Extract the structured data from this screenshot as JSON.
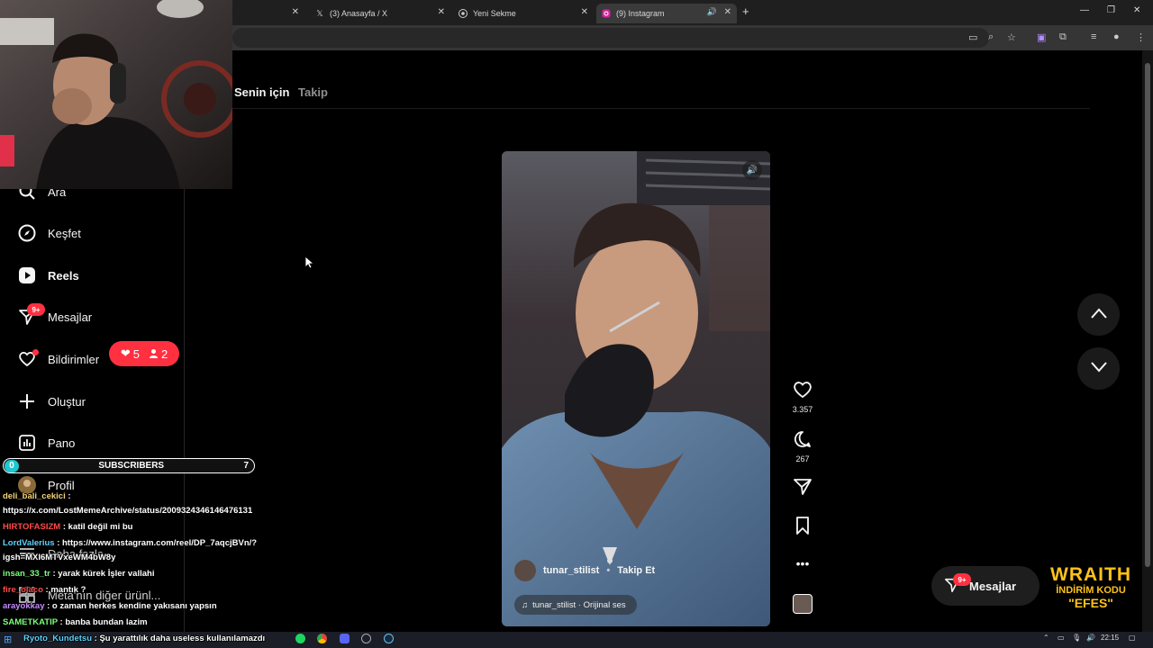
{
  "browser": {
    "tabs": [
      {
        "title": "",
        "icon": "close"
      },
      {
        "title": "(3) Anasayfa / X",
        "icon": "x-logo"
      },
      {
        "title": "Yeni Sekme",
        "icon": "chrome-logo"
      },
      {
        "title": "(9) Instagram",
        "icon": "instagram-logo",
        "active": true
      }
    ],
    "new_tab": "+"
  },
  "feed": {
    "tab_for_you": "Senin için",
    "tab_following": "Takip"
  },
  "sidebar": {
    "items": [
      {
        "label": "Ara",
        "icon": "search-icon"
      },
      {
        "label": "Keşfet",
        "icon": "compass-icon"
      },
      {
        "label": "Reels",
        "icon": "reels-icon"
      },
      {
        "label": "Mesajlar",
        "icon": "messenger-icon",
        "badge": "9+"
      },
      {
        "label": "Bildirimler",
        "icon": "heart-icon"
      },
      {
        "label": "Oluştur",
        "icon": "plus-icon"
      },
      {
        "label": "Pano",
        "icon": "dashboard-icon"
      },
      {
        "label": "Profil",
        "icon": "avatar"
      },
      {
        "label": "Daha fazla",
        "icon": "menu-icon"
      },
      {
        "label": "Meta'nın diğer ürünl...",
        "icon": "grid-icon"
      }
    ],
    "notifications_pill": {
      "likes": "5",
      "follows": "2"
    }
  },
  "reel": {
    "username": "tunar_stilist",
    "follow_label": "Takip Et",
    "separator": "•",
    "audio": "tunar_stilist · Orijinal ses",
    "likes": "3.357",
    "comments": "267"
  },
  "messages_pill": {
    "label": "Mesajlar",
    "badge": "9+"
  },
  "overlay": {
    "subscribers_label": "SUBSCRIBERS",
    "subscribers_start": "0",
    "subscribers_goal": "7",
    "sponsor_line1": "WRAITH",
    "sponsor_line2": "İNDİRİM KODU",
    "sponsor_line3": "\"EFES\""
  },
  "chat": [
    {
      "user": "deli_bali_cekici",
      "color": "#f2d27a",
      "text": " :"
    },
    {
      "user": "",
      "color": "#ffffff",
      "text": "https://x.com/LostMemeArchive/status/2009324346146476131"
    },
    {
      "user": "HIRTOFASIZM",
      "color": "#ff4a4a",
      "text": " : katil değil mi bu"
    },
    {
      "user": "LordValerius",
      "color": "#5fd3ff",
      "text": " : https://www.instagram.com/reel/DP_7aqcjBVn/?"
    },
    {
      "user": "",
      "color": "#ffffff",
      "text": "igsh=MXI6MTVxeWM4bW8y"
    },
    {
      "user": "insan_33_tr",
      "color": "#7dff7d",
      "text": " : yarak kürek İşler vallahi"
    },
    {
      "user": "fire_olaco",
      "color": "#ff4a4a",
      "text": " : mantık ?"
    },
    {
      "user": "arayokkay",
      "color": "#c58cff",
      "text": " : o zaman herkes kendine yakısanı yapsın"
    },
    {
      "user": "SAMETKATIP",
      "color": "#7dff7d",
      "text": " : banba bundan lazim"
    },
    {
      "user": "Ryoto_Kundetsu",
      "color": "#5fd3ff",
      "text": " : Şu yarattılık daha useless kullanılamazdı"
    }
  ],
  "taskbar": {
    "time": "22:15"
  },
  "colors": {
    "accent_red": "#ff3040",
    "background": "#000000"
  }
}
